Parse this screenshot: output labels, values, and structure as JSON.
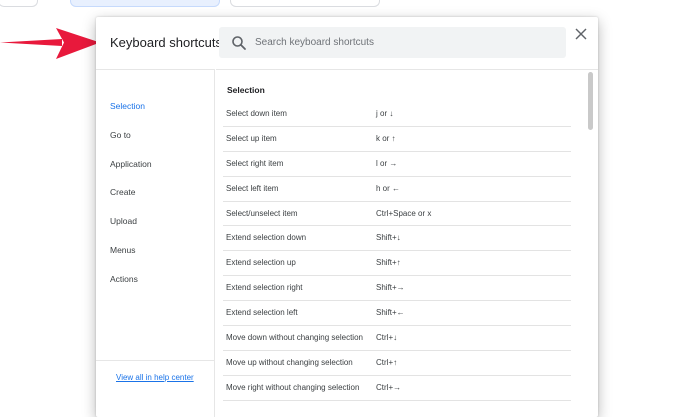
{
  "dialog": {
    "title": "Keyboard shortcuts",
    "search_placeholder": "Search keyboard shortcuts",
    "search_value": ""
  },
  "sidebar": {
    "items": [
      {
        "label": "Selection",
        "active": true
      },
      {
        "label": "Go to",
        "active": false
      },
      {
        "label": "Application",
        "active": false
      },
      {
        "label": "Create",
        "active": false
      },
      {
        "label": "Upload",
        "active": false
      },
      {
        "label": "Menus",
        "active": false
      },
      {
        "label": "Actions",
        "active": false
      }
    ],
    "help_link": "View all in help center"
  },
  "section": {
    "title": "Selection",
    "rows": [
      {
        "action": "Select down item",
        "keys": "j or ↓"
      },
      {
        "action": "Select up item",
        "keys": "k or ↑"
      },
      {
        "action": "Select right item",
        "keys": "l or →"
      },
      {
        "action": "Select left item",
        "keys": "h or ←"
      },
      {
        "action": "Select/unselect item",
        "keys": "Ctrl+Space or x"
      },
      {
        "action": "Extend selection down",
        "keys": "Shift+↓"
      },
      {
        "action": "Extend selection up",
        "keys": "Shift+↑"
      },
      {
        "action": "Extend selection right",
        "keys": "Shift+→"
      },
      {
        "action": "Extend selection left",
        "keys": "Shift+←"
      },
      {
        "action": "Move down without changing selection",
        "keys": "Ctrl+↓"
      },
      {
        "action": "Move up without changing selection",
        "keys": "Ctrl+↑"
      },
      {
        "action": "Move right without changing selection",
        "keys": "Ctrl+→"
      }
    ]
  },
  "colors": {
    "accent": "#1a73e8",
    "annotation_arrow": "#e8193c",
    "search_bg": "#f1f3f4"
  },
  "icons": [
    "search-icon",
    "close-icon",
    "annotation-arrow"
  ]
}
